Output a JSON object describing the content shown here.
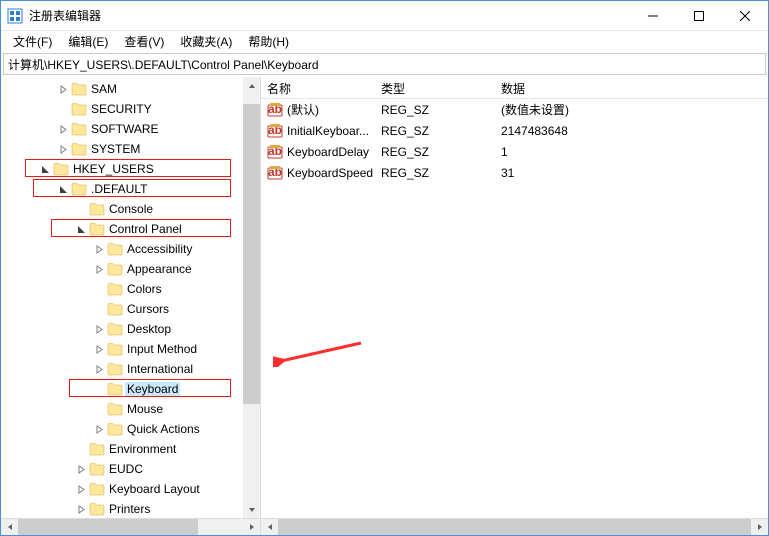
{
  "window": {
    "title": "注册表编辑器"
  },
  "menu": {
    "file": "文件(F)",
    "edit": "编辑(E)",
    "view": "查看(V)",
    "favorites": "收藏夹(A)",
    "help": "帮助(H)"
  },
  "address": "计算机\\HKEY_USERS\\.DEFAULT\\Control Panel\\Keyboard",
  "tree": [
    {
      "label": "SAM",
      "indent": 3,
      "expandable": true,
      "expanded": false
    },
    {
      "label": "SECURITY",
      "indent": 3,
      "expandable": false
    },
    {
      "label": "SOFTWARE",
      "indent": 3,
      "expandable": true,
      "expanded": false
    },
    {
      "label": "SYSTEM",
      "indent": 3,
      "expandable": true,
      "expanded": false
    },
    {
      "label": "HKEY_USERS",
      "indent": 2,
      "expandable": true,
      "expanded": true,
      "highlight": true
    },
    {
      "label": ".DEFAULT",
      "indent": 3,
      "expandable": true,
      "expanded": true,
      "highlight": true
    },
    {
      "label": "Console",
      "indent": 4,
      "expandable": false
    },
    {
      "label": "Control Panel",
      "indent": 4,
      "expandable": true,
      "expanded": true,
      "highlight": true
    },
    {
      "label": "Accessibility",
      "indent": 5,
      "expandable": true,
      "expanded": false
    },
    {
      "label": "Appearance",
      "indent": 5,
      "expandable": true,
      "expanded": false
    },
    {
      "label": "Colors",
      "indent": 5,
      "expandable": false
    },
    {
      "label": "Cursors",
      "indent": 5,
      "expandable": false
    },
    {
      "label": "Desktop",
      "indent": 5,
      "expandable": true,
      "expanded": false
    },
    {
      "label": "Input Method",
      "indent": 5,
      "expandable": true,
      "expanded": false
    },
    {
      "label": "International",
      "indent": 5,
      "expandable": true,
      "expanded": false
    },
    {
      "label": "Keyboard",
      "indent": 5,
      "expandable": false,
      "selected": true,
      "highlight": true
    },
    {
      "label": "Mouse",
      "indent": 5,
      "expandable": false
    },
    {
      "label": "Quick Actions",
      "indent": 5,
      "expandable": true,
      "expanded": false
    },
    {
      "label": "Environment",
      "indent": 4,
      "expandable": false
    },
    {
      "label": "EUDC",
      "indent": 4,
      "expandable": true,
      "expanded": false
    },
    {
      "label": "Keyboard Layout",
      "indent": 4,
      "expandable": true,
      "expanded": false
    },
    {
      "label": "Printers",
      "indent": 4,
      "expandable": true,
      "expanded": false
    }
  ],
  "list": {
    "columns": {
      "name": "名称",
      "type": "类型",
      "data": "数据"
    },
    "rows": [
      {
        "name": "(默认)",
        "type": "REG_SZ",
        "data": "(数值未设置)"
      },
      {
        "name": "InitialKeyboar...",
        "type": "REG_SZ",
        "data": "2147483648"
      },
      {
        "name": "KeyboardDelay",
        "type": "REG_SZ",
        "data": "1"
      },
      {
        "name": "KeyboardSpeed",
        "type": "REG_SZ",
        "data": "31"
      }
    ]
  }
}
